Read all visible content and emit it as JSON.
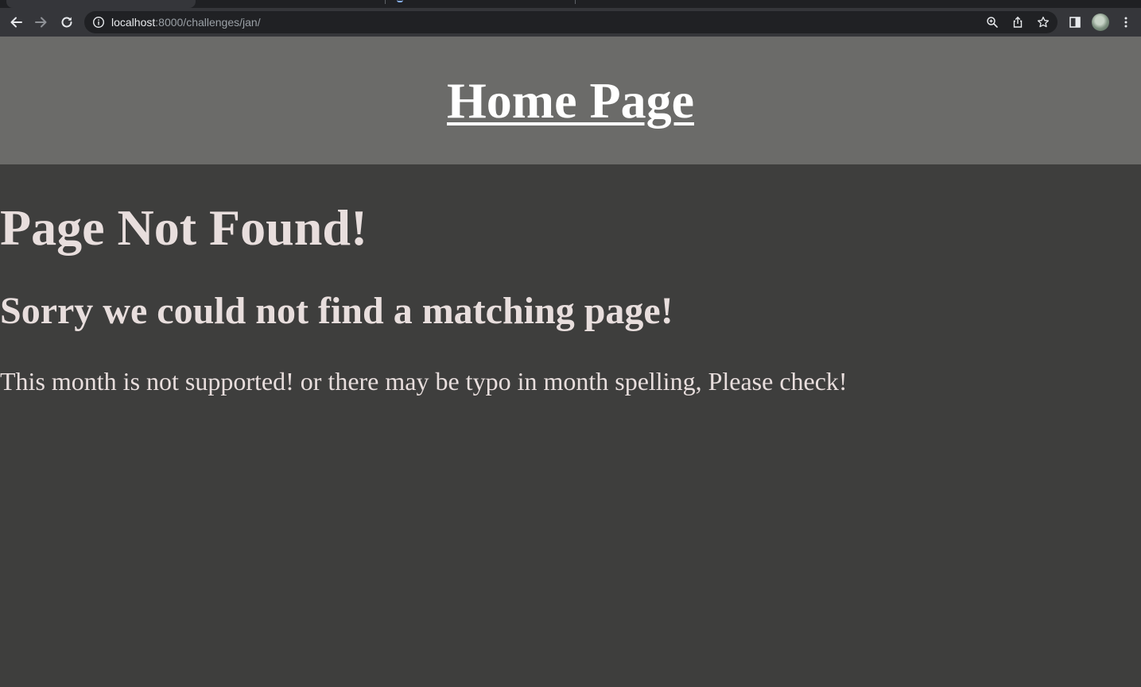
{
  "browser": {
    "address_bar": {
      "host": "localhost",
      "path": ":8000/challenges/jan/"
    },
    "icons": {
      "back": "back-arrow-icon",
      "forward": "forward-arrow-icon",
      "reload": "reload-icon",
      "site_info": "info-icon",
      "zoom": "zoom-icon",
      "share": "share-icon",
      "bookmark": "star-icon",
      "side_panel": "side-panel-icon",
      "profile": "avatar",
      "menu": "kebab-menu-icon"
    }
  },
  "header": {
    "home_link": "Home Page"
  },
  "main": {
    "title": "Page Not Found!",
    "subtitle": "Sorry we could not find a matching page!",
    "message": "This month is not supported! or there may be typo in month spelling, Please check!"
  },
  "colors": {
    "page_background": "#3e3e3d",
    "header_background": "#6b6b69",
    "header_link": "#ffffff",
    "body_text": "#e8dedd"
  }
}
